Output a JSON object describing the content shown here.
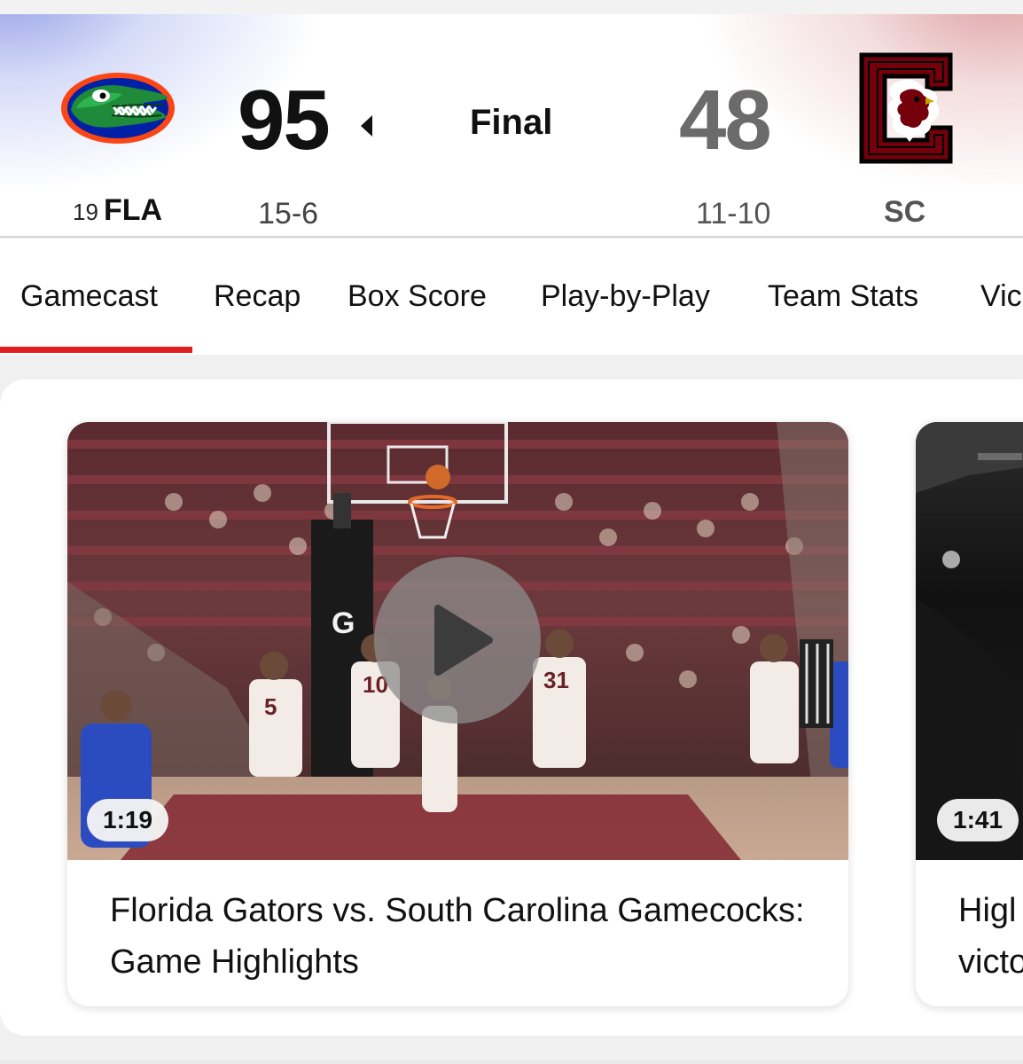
{
  "scoreboard": {
    "status": "Final",
    "away": {
      "rank": "19",
      "abbr": "FLA",
      "score": "95",
      "record": "15-6",
      "logo_icon": "florida-gators-logo-icon",
      "color": "#0021a5"
    },
    "home": {
      "abbr": "SC",
      "score": "48",
      "record": "11-10",
      "logo_icon": "south-carolina-gamecocks-logo-icon",
      "color": "#73000a"
    }
  },
  "tabs": [
    {
      "label": "Gamecast",
      "active": true
    },
    {
      "label": "Recap"
    },
    {
      "label": "Box Score"
    },
    {
      "label": "Play-by-Play"
    },
    {
      "label": "Team Stats"
    },
    {
      "label": "Vic"
    }
  ],
  "videos": [
    {
      "duration": "1:19",
      "title": "Florida Gators vs. South Carolina Gamecocks: Game Highlights"
    },
    {
      "duration": "1:41",
      "title_line1": "Higl",
      "title_line2": "victo"
    }
  ],
  "colors": {
    "accent": "#e0201f"
  }
}
